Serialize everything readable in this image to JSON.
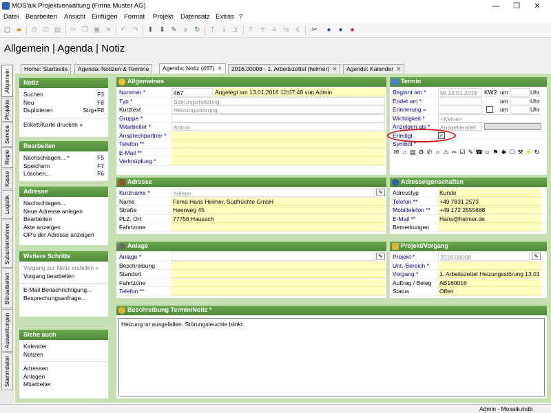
{
  "window": {
    "title": "MOS'aik Projektverwaltung (Firma Muster AG)",
    "minimize": "—",
    "restore": "❐",
    "close": "✕"
  },
  "menu": [
    "Datei",
    "Bearbeiten",
    "Ansicht",
    "Einfügen",
    "Format",
    "Projekt",
    "Datensatz",
    "Extras",
    "?"
  ],
  "page_title": "Allgemein | Agenda | Notiz",
  "vtabs": [
    "Allgemein",
    "Projekte",
    "Service",
    "Regie",
    "Kasse",
    "Logistik",
    "Subunternehmer",
    "Büroarbeiten",
    "Auswertungen",
    "Stammdaten"
  ],
  "tabs": [
    "Home: Startseite",
    "Agenda: Notizen & Termine",
    "Agenda: Notiz (467)",
    "2016.00008 - 1. Arbeitszettel (helmer)",
    "Agenda: Kalender"
  ],
  "tab_close": "✕",
  "left": {
    "notiz": {
      "title": "Notiz",
      "rows": [
        {
          "label": "Suchen",
          "key": "F3"
        },
        {
          "label": "Neu",
          "key": "F8"
        },
        {
          "label": "Duplizieren",
          "key": "Strg+F8"
        }
      ],
      "extra": "Etikett/Karte drucken »"
    },
    "bearbeiten": {
      "title": "Bearbeiten",
      "rows": [
        {
          "label": "Nachschlagen... *",
          "key": "F5"
        },
        {
          "label": "Speichern",
          "key": "F7"
        },
        {
          "label": "Löschen...",
          "key": "F6"
        }
      ]
    },
    "adresse": {
      "title": "Adresse",
      "rows": [
        "Nachschlagen...",
        "Neue Adresse anlegen",
        "Bearbeiten",
        "Akte anzeigen",
        "OP's der Adresse anzeigen"
      ]
    },
    "weitere": {
      "title": "Weitere Schritte",
      "rows": [
        "Vorgang zur Notiz erstellen »",
        "Vorgang bearbeiten",
        "E-Mail Benachrichtigung...",
        "Besprechungsanfrage..."
      ]
    },
    "siehe": {
      "title": "Siehe auch",
      "rows": [
        "Kalender",
        "Notizen",
        "Adressen",
        "Anlagen",
        "Mitarbeiter"
      ]
    }
  },
  "allgemeines": {
    "title": "Allgemeines",
    "labels": [
      "Nummer *",
      "Typ *",
      "Kurztext",
      "Gruppe *",
      "Mitarbeiter *",
      "Ansprechpartner *",
      "Telefon **",
      "E-Mail **",
      "Verknüpfung *"
    ],
    "nummer": "467",
    "angelegt": "Angelegt am 13.01.2016 12:07:48 von Admin",
    "typ": "Störungsmeldung",
    "kurztext": "Heizungsstörung",
    "gruppe": "",
    "mitarbeiter": "Admin"
  },
  "termin": {
    "title": "Termin",
    "labels": [
      "Beginnt am *",
      "Endet am *",
      "Erinnerung »",
      "Wichtigkeit *",
      "Anzeigen als *",
      "Erledigt",
      "Symbol *"
    ],
    "beginnt": "Mi 13.01.2016",
    "kw": "KW2",
    "um": "um",
    "uhr": "Uhr",
    "wichtigkeit": "<Keine>",
    "anzeigen": "Ausgeblendet",
    "erledigt_check": "✓",
    "symbols": [
      "✉",
      "⌂",
      "▤",
      "⚙",
      "✆",
      "☼",
      "⚠",
      "✂",
      "☑",
      "✎",
      "☎",
      "☺",
      "⚑",
      "✱",
      "☐",
      "⚒",
      "⚡",
      "↻"
    ]
  },
  "adresse": {
    "title": "Adresse",
    "labels": [
      "Kurzname *",
      "Name",
      "Straße",
      "PLZ, Ort",
      "Fahrtzone"
    ],
    "kurzname": "helmer",
    "name": "Firma Hans Helmer, Südfrüchte GmbH",
    "strasse": "Heerweg 45",
    "plzort": "77756 Hausach",
    "fahrtzone": ""
  },
  "adresseigenschaften": {
    "title": "Adresseigenschaften",
    "labels": [
      "Adresstyp",
      "Telefon **",
      "Mobiltelefon **",
      "E-Mail **",
      "Bemerkungen"
    ],
    "adresstyp": "Kunde",
    "telefon": "+49 7831 2573",
    "mobil": "+49 172 2555688",
    "email": "Hans@helmer.de",
    "bemerkungen": ""
  },
  "anlage": {
    "title": "Anlage",
    "labels": [
      "Anlage *",
      "Beschreibung",
      "Standort",
      "Fahrtzone",
      "Telefon **"
    ]
  },
  "projekt": {
    "title": "Projekt/Vorgang",
    "labels": [
      "Projekt *",
      "Unt.-Bereich *",
      "Vorgang *",
      "Auftrag / Beleg",
      "Status"
    ],
    "projekt": "2016.00008",
    "vorgang": "1. Arbeitszettel Heizungsstörung 13.01",
    "auftrag": "AB160016",
    "status": "Offen"
  },
  "beschreibung": {
    "title": "Beschreibung Termin/Notiz *",
    "text": "Heizung ist ausgefallen. Störungsleuchte blinkt."
  },
  "status": {
    "user": "Admin - Mosaik.mdb"
  },
  "pen_glyph": "✎"
}
